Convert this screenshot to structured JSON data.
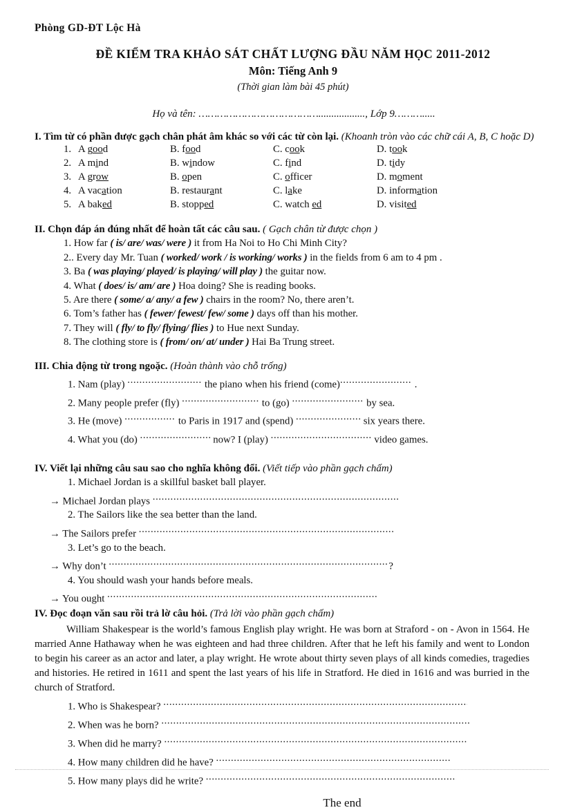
{
  "header": {
    "org": "Phòng  GD-ĐT Lộc Hà",
    "title": "ĐỀ KIỂM  TRA  KHẢO  SÁT  CHẤT  LƯỢNG  ĐẦU  NĂM  HỌC  2011-2012",
    "subject": "Môn:  Tiếng  Anh 9",
    "duration": "(Thời gian làm bài 45 phút)",
    "name_field": "Họ và tên: ………………………………….................., Lớp 9………....."
  },
  "part1": {
    "heading_bold": "I. Tìm từ có phần  được  gạch chân phát  âm khác  so với các từ còn lại.",
    "heading_italic": "(Khoanh tròn vào các chữ cái A, B, C hoặc D)",
    "rows": [
      {
        "n": "1.",
        "a": {
          "label": "A",
          "pre": "g",
          "ul": "oo",
          "post": "d"
        },
        "b": {
          "label": "B.",
          "pre": "f",
          "ul": "oo",
          "post": "d"
        },
        "c": {
          "label": "C.",
          "pre": "c",
          "ul": "oo",
          "post": "k"
        },
        "d": {
          "label": "D.",
          "pre": "t",
          "ul": "oo",
          "post": "k"
        }
      },
      {
        "n": "2.",
        "a": {
          "label": "A",
          "pre": "m",
          "ul": "i",
          "post": "nd"
        },
        "b": {
          "label": "B.",
          "pre": "w",
          "ul": "i",
          "post": "ndow"
        },
        "c": {
          "label": "C.",
          "pre": "f",
          "ul": "i",
          "post": "nd"
        },
        "d": {
          "label": "D.",
          "pre": "t",
          "ul": "i",
          "post": "dy"
        }
      },
      {
        "n": "3.",
        "a": {
          "label": "A",
          "pre": "gr",
          "ul": "ow",
          "post": ""
        },
        "b": {
          "label": "B.",
          "pre": "",
          "ul": "o",
          "post": "pen"
        },
        "c": {
          "label": "C.",
          "pre": "",
          "ul": "o",
          "post": "fficer"
        },
        "d": {
          "label": "D.",
          "pre": "m",
          "ul": "o",
          "post": "ment"
        }
      },
      {
        "n": "4.",
        "a": {
          "label": "A",
          "pre": "vac",
          "ul": "a",
          "post": "tion"
        },
        "b": {
          "label": "B.",
          "pre": "restaur",
          "ul": "a",
          "post": "nt"
        },
        "c": {
          "label": "C.",
          "pre": "l",
          "ul": "a",
          "post": "ke"
        },
        "d": {
          "label": "D.",
          "pre": "inform",
          "ul": "a",
          "post": "tion"
        }
      },
      {
        "n": "5.",
        "a": {
          "label": "A",
          "pre": "bak",
          "ul": "ed",
          "post": ""
        },
        "b": {
          "label": "B.",
          "pre": "stopp",
          "ul": "ed",
          "post": ""
        },
        "c": {
          "label": "C.",
          "pre": "watch ",
          "ul": "ed",
          "post": ""
        },
        "d": {
          "label": "D.",
          "pre": "visit",
          "ul": "ed",
          "post": ""
        }
      }
    ]
  },
  "part2": {
    "heading_bold": "II. Chọn đáp án đúng nhất để hoàn tất các câu sau.",
    "heading_italic": "( Gạch chân từ được chọn )",
    "items": [
      {
        "n": "1.",
        "pre": "How  far ",
        "choice": "( is/ are/ was/ were )",
        "post": "  it from Ha Noi to Ho Chi Minh City?"
      },
      {
        "n": "2..",
        "pre": "Every day Mr. Tuan ",
        "choice": "( worked/ work / is working/ works )",
        "post": "  in the fields from 6 am to 4 pm ."
      },
      {
        "n": "3.",
        "pre": "Ba ",
        "choice": "( was playing/  played/ is playing/ will play )",
        "post": " the guitar now."
      },
      {
        "n": "4.",
        "pre": "What ",
        "choice": "( does/ is/ am/ are )",
        "post": " Hoa doing? She is reading books."
      },
      {
        "n": "5.",
        "pre": "Are there ",
        "choice": "( some/ a/ any/ a few )",
        "post": " chairs in the room? No, there aren’t."
      },
      {
        "n": "6.",
        "pre": "Tom’s father has ",
        "choice": "( fewer/ fewest/ few/ some )",
        "post": " days off than his mother."
      },
      {
        "n": "7.",
        "pre": "They will ",
        "choice": "( fly/ to fly/ flying/ flies )",
        "post": " to Hue next Sunday."
      },
      {
        "n": "8.",
        "pre": "The clothing store is ",
        "choice": "( from/ on/ at/ under )",
        "post": " Hai Ba Trung street."
      }
    ]
  },
  "part3": {
    "heading_bold": "III.  Chia động từ trong ngoặc.",
    "heading_italic": "(Hoàn thành vào chỗ trống)",
    "items": [
      {
        "n": "1.",
        "parts": [
          "Nam (play) ",
          " the piano when his friend (come)",
          "   ."
        ],
        "dots": [
          108,
          104
        ]
      },
      {
        "n": "2.",
        "parts": [
          "Many people prefer (fly) ",
          " to (go) ",
          " by sea."
        ],
        "dots": [
          112,
          104
        ]
      },
      {
        "n": "3.",
        "parts": [
          "He (move) ",
          " to Paris in 1917 and (spend) ",
          " six years there."
        ],
        "dots": [
          74,
          94
        ]
      },
      {
        "n": "4.",
        "parts": [
          "What you (do) ",
          " now? I (play) ",
          " video games."
        ],
        "dots": [
          102,
          146
        ]
      }
    ]
  },
  "part4": {
    "heading_bold": "IV.  Viết lại những  câu sau sao cho nghĩa không  đổi.",
    "heading_italic": "(Viết tiếp vào phần gạch chấm)",
    "items": [
      {
        "n": "1.",
        "sentence": "Michael Jordan is a skillful basket ball player.",
        "answer_prefix": "→ Michael Jordan plays ",
        "dots": 355,
        "tail": ""
      },
      {
        "n": "2.",
        "sentence": "The Sailors like the sea better than the land.",
        "answer_prefix": "→ The Sailors prefer ",
        "dots": 370,
        "tail": ""
      },
      {
        "n": "3.",
        "sentence": "Let’s go to the beach.",
        "answer_prefix": "→ Why don’t ",
        "dots": 405,
        "tail": "?"
      },
      {
        "n": "4.",
        "sentence": "You should wash your hands  before meals.",
        "answer_prefix": "→ You ought  ",
        "dots": 390,
        "tail": ""
      }
    ]
  },
  "part5": {
    "heading_bold": "IV. Đọc đoạn văn sau rồi trả lờ câu hỏi.",
    "heading_italic": "(Trả lời vào phần gạch chấm)",
    "passage": "William Shakespear  is the world’s famous English play wright.  He was born at Straford - on - Avon  in 1564. He married Anne  Hathaway  when he was eighteen and had three children.  After that he left his family and went to London to begin his career as an actor and later, a play  wright. He wrote about thirty seven plays of all kinds  comedies, tragedies and histories. He retired in 1611 and spent the last years of his life in Stratford.  He died in 1616 and was burried in the church of Stratford.",
    "questions": [
      {
        "n": "1.",
        "text": "Who is Shakespear?",
        "dots": 440
      },
      {
        "n": "2.",
        "text": "When was he born?",
        "dots": 448
      },
      {
        "n": "3.",
        "text": "When did he marry?",
        "dots": 440
      },
      {
        "n": "4.",
        "text": "How many  children  did he have?",
        "dots": 340
      },
      {
        "n": "5.",
        "text": "How many  plays did he write?",
        "dots": 362
      }
    ]
  },
  "footer": {
    "the_end": "The  end"
  }
}
